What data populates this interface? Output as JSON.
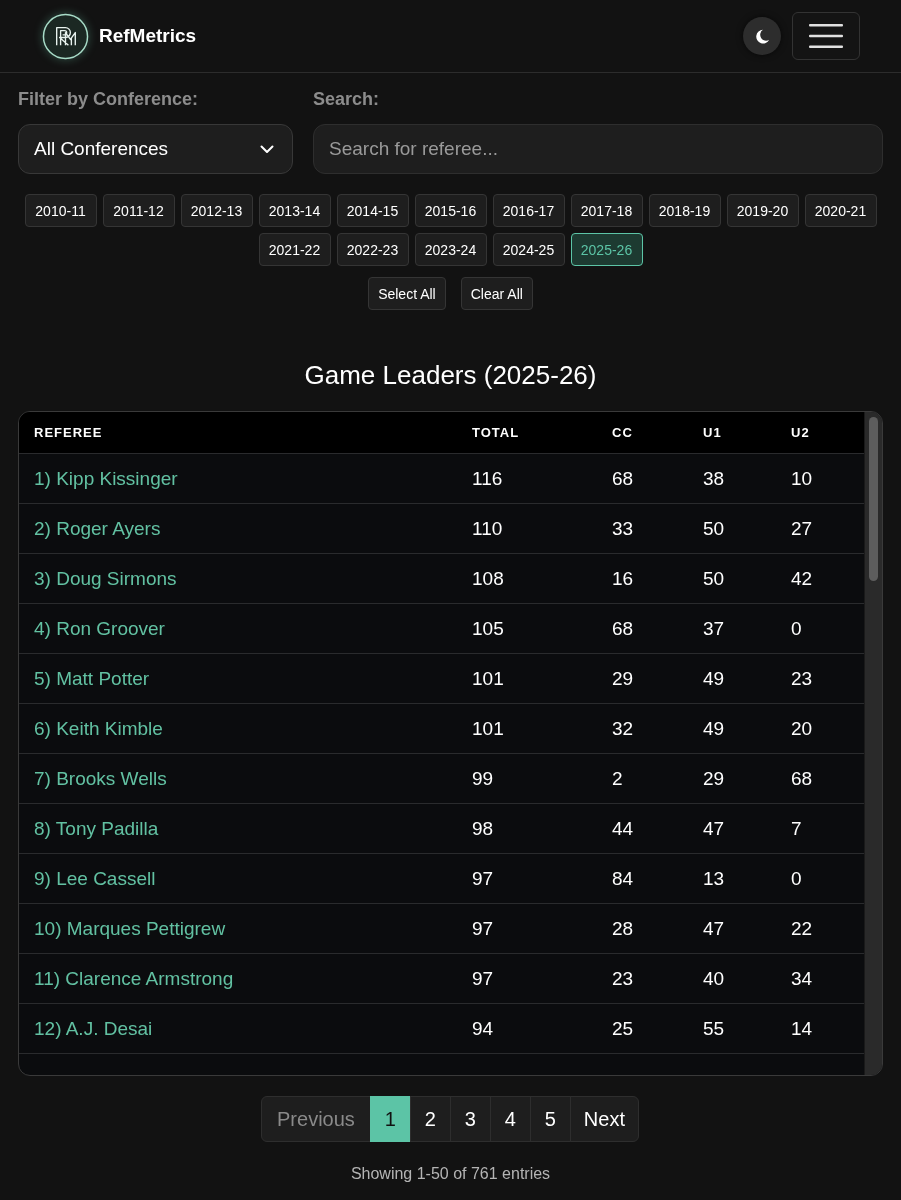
{
  "navbar": {
    "brand": "RefMetrics"
  },
  "conference_filter": {
    "label": "Filter by Conference:",
    "value": "All Conferences"
  },
  "search": {
    "label": "Search:",
    "placeholder": "Search for referee..."
  },
  "seasons": [
    {
      "label": "2010-11",
      "selected": false
    },
    {
      "label": "2011-12",
      "selected": false
    },
    {
      "label": "2012-13",
      "selected": false
    },
    {
      "label": "2013-14",
      "selected": false
    },
    {
      "label": "2014-15",
      "selected": false
    },
    {
      "label": "2015-16",
      "selected": false
    },
    {
      "label": "2016-17",
      "selected": false
    },
    {
      "label": "2017-18",
      "selected": false
    },
    {
      "label": "2018-19",
      "selected": false
    },
    {
      "label": "2019-20",
      "selected": false
    },
    {
      "label": "2020-21",
      "selected": false
    },
    {
      "label": "2021-22",
      "selected": false
    },
    {
      "label": "2022-23",
      "selected": false
    },
    {
      "label": "2023-24",
      "selected": false
    },
    {
      "label": "2024-25",
      "selected": false
    },
    {
      "label": "2025-26",
      "selected": true
    }
  ],
  "season_actions": [
    "Select All",
    "Clear All"
  ],
  "table": {
    "title": "Game Leaders (2025-26)",
    "columns": [
      "REFEREE",
      "TOTAL",
      "CC",
      "U1",
      "U2"
    ],
    "rows": [
      {
        "referee": "1) Kipp Kissinger",
        "total": "116",
        "cc": "68",
        "u1": "38",
        "u2": "10"
      },
      {
        "referee": "2) Roger Ayers",
        "total": "110",
        "cc": "33",
        "u1": "50",
        "u2": "27"
      },
      {
        "referee": "3) Doug Sirmons",
        "total": "108",
        "cc": "16",
        "u1": "50",
        "u2": "42"
      },
      {
        "referee": "4) Ron Groover",
        "total": "105",
        "cc": "68",
        "u1": "37",
        "u2": "0"
      },
      {
        "referee": "5) Matt Potter",
        "total": "101",
        "cc": "29",
        "u1": "49",
        "u2": "23"
      },
      {
        "referee": "6) Keith Kimble",
        "total": "101",
        "cc": "32",
        "u1": "49",
        "u2": "20"
      },
      {
        "referee": "7) Brooks Wells",
        "total": "99",
        "cc": "2",
        "u1": "29",
        "u2": "68"
      },
      {
        "referee": "8) Tony Padilla",
        "total": "98",
        "cc": "44",
        "u1": "47",
        "u2": "7"
      },
      {
        "referee": "9) Lee Cassell",
        "total": "97",
        "cc": "84",
        "u1": "13",
        "u2": "0"
      },
      {
        "referee": "10) Marques Pettigrew",
        "total": "97",
        "cc": "28",
        "u1": "47",
        "u2": "22"
      },
      {
        "referee": "11) Clarence Armstrong",
        "total": "97",
        "cc": "23",
        "u1": "40",
        "u2": "34"
      },
      {
        "referee": "12) A.J. Desai",
        "total": "94",
        "cc": "25",
        "u1": "55",
        "u2": "14"
      }
    ]
  },
  "pagination": {
    "previous": {
      "label": "Previous",
      "disabled": true
    },
    "pages": [
      {
        "label": "1",
        "selected": true
      },
      {
        "label": "2",
        "selected": false
      },
      {
        "label": "3",
        "selected": false
      },
      {
        "label": "4",
        "selected": false
      },
      {
        "label": "5",
        "selected": false
      }
    ],
    "next": {
      "label": "Next",
      "disabled": false
    }
  },
  "summary": "Showing 1-50 of 761 entries"
}
